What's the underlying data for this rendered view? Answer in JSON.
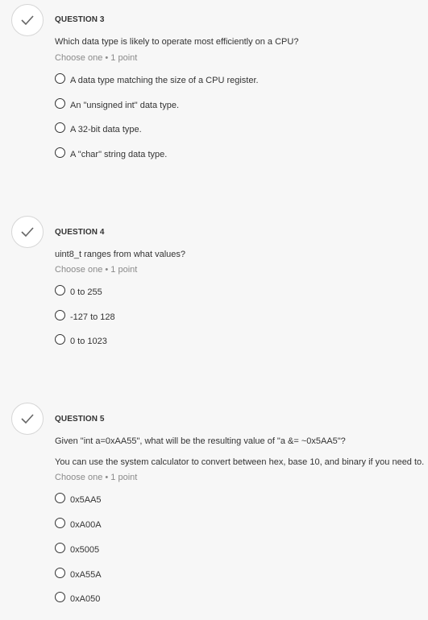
{
  "questions": [
    {
      "label": "QUESTION 3",
      "prompt": "Which data type is likely to operate most efficiently on a CPU?",
      "note": "",
      "meta": "Choose one • 1 point",
      "options": [
        "A data type matching the size of a CPU register.",
        "An \"unsigned int\" data type.",
        "A 32-bit data type.",
        "A \"char\" string data type."
      ]
    },
    {
      "label": "QUESTION 4",
      "prompt": "uint8_t ranges from what values?",
      "note": "",
      "meta": "Choose one • 1 point",
      "options": [
        "0 to 255",
        "-127 to 128",
        "0 to 1023"
      ]
    },
    {
      "label": "QUESTION 5",
      "prompt": "Given \"int a=0xAA55\", what will be the resulting value of \"a &= ~0x5AA5\"?",
      "note": "You can use the system calculator to convert between hex, base 10, and binary if you need to.",
      "meta": "Choose one • 1 point",
      "options": [
        "0x5AA5",
        "0xA00A",
        "0x5005",
        "0xA55A",
        "0xA050"
      ]
    }
  ],
  "icons": {
    "completed": "checkmark-icon",
    "option": "radio-icon"
  },
  "colors": {
    "background": "#f7f7f7",
    "text": "#333333",
    "meta": "#8a8a8a",
    "check": "#666666"
  }
}
